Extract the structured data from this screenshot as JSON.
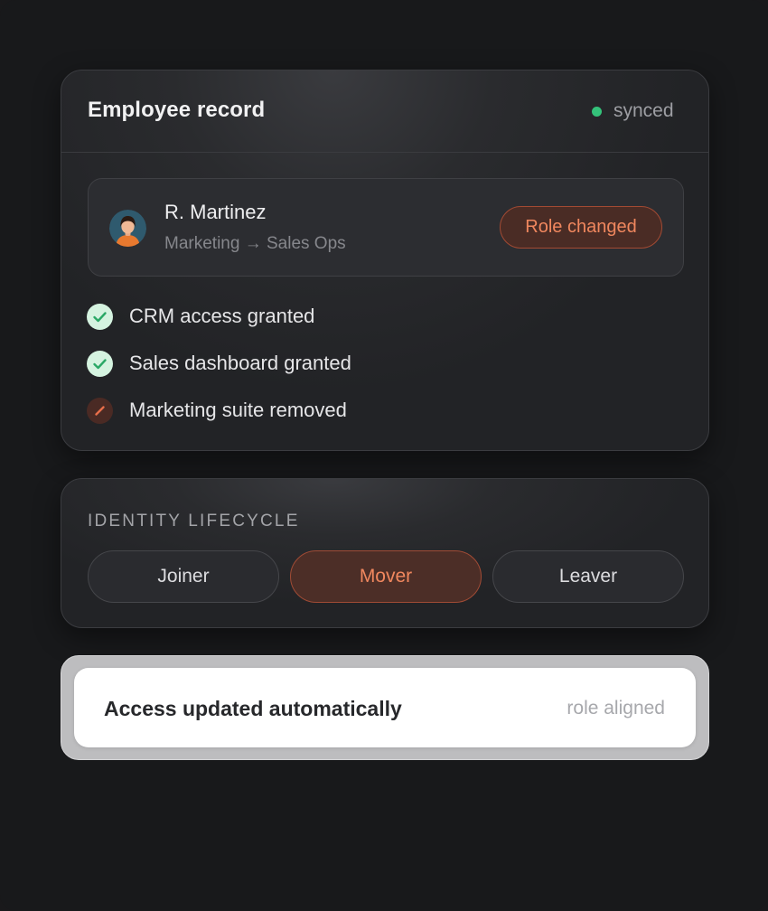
{
  "record": {
    "title": "Employee record",
    "status": "synced",
    "status_color": "#34c27a",
    "employee": {
      "name": "R. Martinez",
      "move": "Marketing → Sales Ops",
      "badge": "Role changed"
    },
    "access_changes": [
      {
        "label": "CRM access granted",
        "icon": "check-icon",
        "state": "granted"
      },
      {
        "label": "Sales dashboard granted",
        "icon": "check-icon",
        "state": "granted"
      },
      {
        "label": "Marketing suite removed",
        "icon": "slash-icon",
        "state": "removed"
      }
    ]
  },
  "lifecycle": {
    "title": "IDENTITY LIFECYCLE",
    "stages": [
      {
        "label": "Joiner",
        "active": false
      },
      {
        "label": "Mover",
        "active": true
      },
      {
        "label": "Leaver",
        "active": false
      }
    ]
  },
  "notice": {
    "title": "Access updated automatically",
    "tag": "role aligned"
  },
  "colors": {
    "accent": "#f0875e",
    "success": "#34c27a",
    "background": "#18191b"
  }
}
